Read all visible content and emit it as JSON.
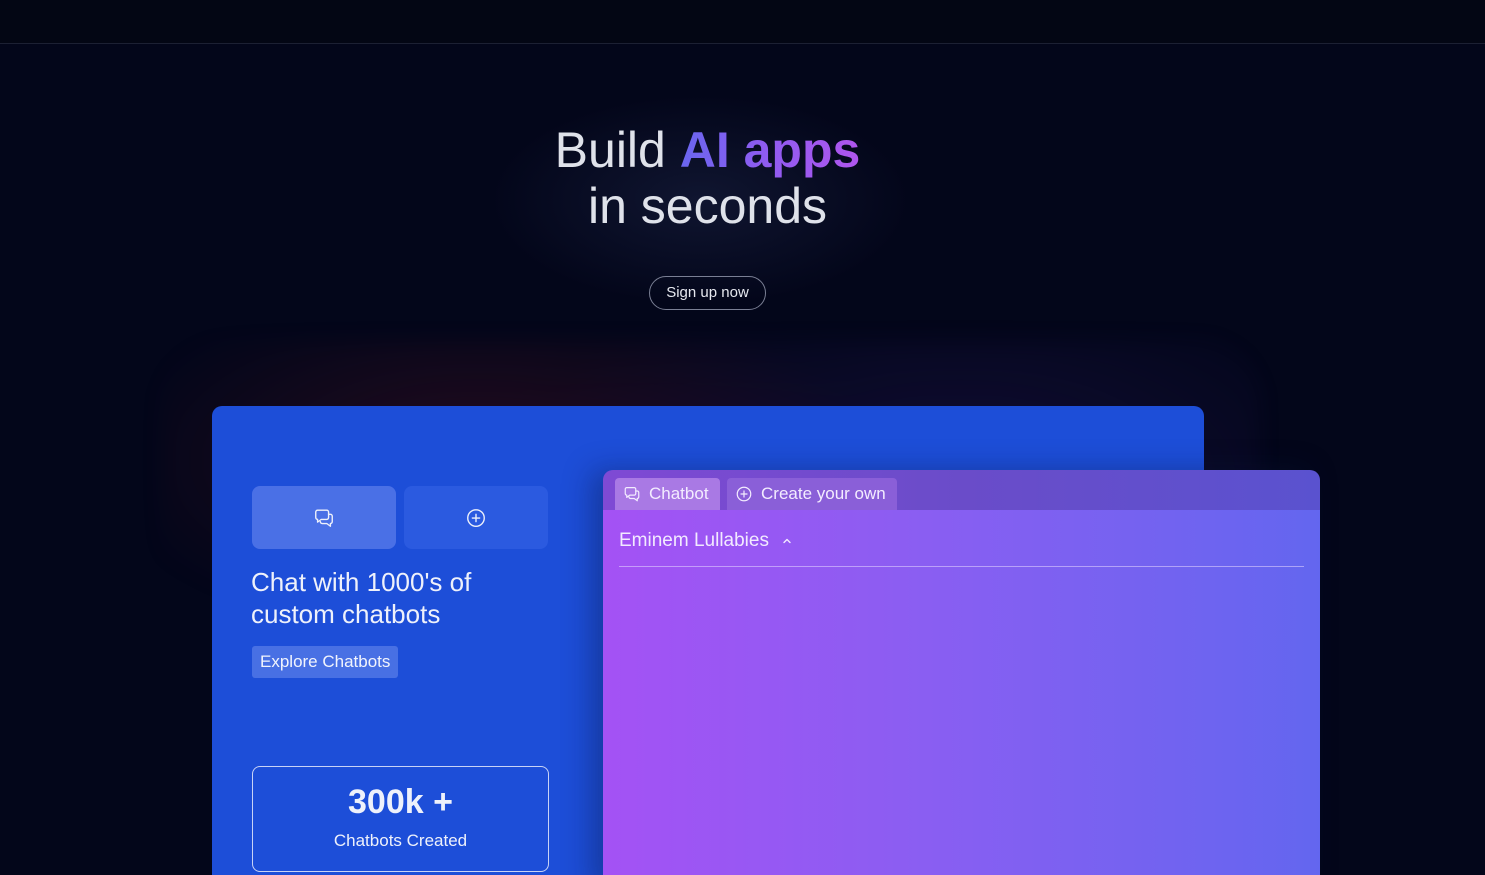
{
  "hero": {
    "title_line1_prefix": "Build ",
    "title_accent": "AI apps",
    "title_line2": "in seconds",
    "signup_label": "Sign up now"
  },
  "feature_card": {
    "heading": "Chat with 1000's of custom chatbots",
    "explore_label": "Explore Chatbots",
    "tiles": [
      {
        "icon": "chat-bubbles-icon"
      },
      {
        "icon": "plus-circle-icon"
      }
    ],
    "stat": {
      "value": "300k +",
      "label": "Chatbots Created"
    }
  },
  "preview": {
    "tabs": [
      {
        "label": "Chatbot",
        "icon": "chat-bubbles-icon"
      },
      {
        "label": "Create your own",
        "icon": "plus-circle-icon"
      }
    ],
    "bot_name": "Eminem Lullabies"
  },
  "colors": {
    "background": "#03061a",
    "card_blue": "#1d4ed8",
    "accent_start": "#6a66ef",
    "accent_end": "#b055ee",
    "preview_gradient_start": "#a452f4",
    "preview_gradient_end": "#6366ef"
  }
}
